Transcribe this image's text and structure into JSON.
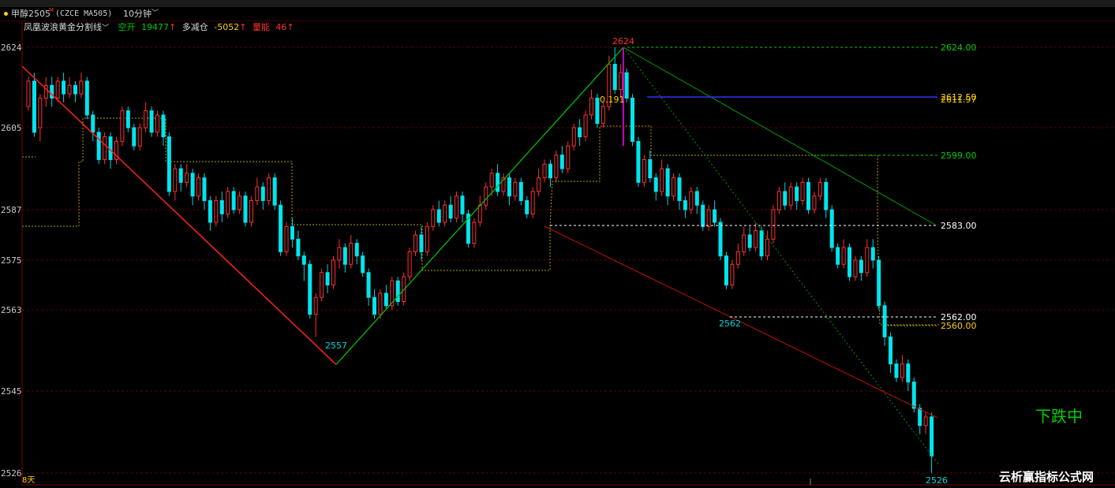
{
  "header": {
    "symbol": "甲醇2505",
    "symbol_mark": "M",
    "code": "(CZCE MA505)",
    "period": "10分钟",
    "period_icon": "chevron-down-icon"
  },
  "indicator": {
    "name": "凤凰波浪黄金分割线",
    "name_icon": "chevron-down-icon",
    "open_label": "空开",
    "open_value": "19477",
    "reduce_label": "多减仓",
    "reduce_value": "-5052",
    "volume_label": "量能",
    "volume_value": "46",
    "up_arrow": "↑"
  },
  "status_text": "下跌中",
  "watermark": "云析赢指标公式网",
  "days_label": "8天",
  "colors": {
    "up": "#ff3030",
    "down": "#00e5ee",
    "green": "#00c000",
    "yellow": "#ffd000",
    "blue": "#3030ff",
    "grid": "#5a0000"
  },
  "chart_data": {
    "type": "candlestick",
    "y_ticks": [
      "2624",
      "2605",
      "2587",
      "2575",
      "2563",
      "2545",
      "2526"
    ],
    "ylim": [
      2526,
      2624
    ],
    "pivot_labels": [
      "2624",
      "2557",
      "2562",
      "2526"
    ],
    "levels": [
      {
        "label": "2624.00",
        "value": 2624.0
      },
      {
        "label": "2612.50",
        "value": 2612.5
      },
      {
        "label": "2611.97",
        "value": 2611.97
      },
      {
        "label": "2599.00",
        "value": 2599.0
      },
      {
        "label": "2583.00",
        "value": 2583.0
      },
      {
        "label": "2562.00",
        "value": 2562.0
      },
      {
        "label": "2560.00",
        "value": 2560.0
      }
    ],
    "fib_label": "0.191",
    "zigzag": [
      {
        "bar": 0,
        "price": 2620
      },
      {
        "bar": 75,
        "price": 2557
      },
      {
        "bar": 143,
        "price": 2624
      },
      {
        "bar": 210,
        "price": 2562
      },
      {
        "bar": 210,
        "price": 2526
      }
    ],
    "candles": [
      [
        2610,
        2616,
        2609,
        2617
      ],
      [
        2616,
        2604,
        2603,
        2618
      ],
      [
        2605,
        2612,
        2602,
        2613
      ],
      [
        2612,
        2615,
        2610,
        2617
      ],
      [
        2615,
        2612,
        2610,
        2617
      ],
      [
        2612,
        2616,
        2611,
        2617
      ],
      [
        2616,
        2613,
        2611,
        2618
      ],
      [
        2613,
        2615,
        2612,
        2617
      ],
      [
        2615,
        2613,
        2611,
        2616
      ],
      [
        2613,
        2616,
        2612,
        2618
      ],
      [
        2616,
        2608,
        2607,
        2617
      ],
      [
        2608,
        2604,
        2602,
        2609
      ],
      [
        2604,
        2598,
        2597,
        2605
      ],
      [
        2598,
        2603,
        2597,
        2604
      ],
      [
        2603,
        2598,
        2596,
        2604
      ],
      [
        2598,
        2602,
        2597,
        2603
      ],
      [
        2602,
        2609,
        2601,
        2610
      ],
      [
        2609,
        2605,
        2604,
        2610
      ],
      [
        2605,
        2601,
        2600,
        2606
      ],
      [
        2601,
        2605,
        2600,
        2606
      ],
      [
        2605,
        2609,
        2604,
        2611
      ],
      [
        2609,
        2604,
        2603,
        2610
      ],
      [
        2604,
        2608,
        2603,
        2609
      ],
      [
        2608,
        2603,
        2601,
        2609
      ],
      [
        2603,
        2591,
        2590,
        2604
      ],
      [
        2591,
        2596,
        2589,
        2597
      ],
      [
        2596,
        2593,
        2591,
        2597
      ],
      [
        2593,
        2595,
        2592,
        2597
      ],
      [
        2595,
        2590,
        2588,
        2596
      ],
      [
        2590,
        2594,
        2589,
        2595
      ],
      [
        2594,
        2589,
        2587,
        2595
      ],
      [
        2589,
        2584,
        2582,
        2590
      ],
      [
        2584,
        2589,
        2583,
        2590
      ],
      [
        2589,
        2586,
        2584,
        2591
      ],
      [
        2586,
        2591,
        2585,
        2592
      ],
      [
        2591,
        2587,
        2586,
        2592
      ],
      [
        2587,
        2590,
        2586,
        2591
      ],
      [
        2590,
        2584,
        2583,
        2591
      ],
      [
        2584,
        2589,
        2583,
        2590
      ],
      [
        2589,
        2592,
        2588,
        2594
      ],
      [
        2592,
        2589,
        2587,
        2593
      ],
      [
        2589,
        2594,
        2588,
        2595
      ],
      [
        2594,
        2588,
        2587,
        2595
      ],
      [
        2588,
        2577,
        2576,
        2589
      ],
      [
        2577,
        2583,
        2576,
        2584
      ],
      [
        2583,
        2580,
        2578,
        2585
      ],
      [
        2580,
        2576,
        2575,
        2582
      ],
      [
        2576,
        2574,
        2570,
        2577
      ],
      [
        2574,
        2562,
        2561,
        2575
      ],
      [
        2562,
        2566,
        2557,
        2567
      ],
      [
        2566,
        2572,
        2565,
        2573
      ],
      [
        2572,
        2569,
        2567,
        2574
      ],
      [
        2569,
        2575,
        2568,
        2576
      ],
      [
        2575,
        2578,
        2573,
        2580
      ],
      [
        2578,
        2574,
        2572,
        2579
      ],
      [
        2574,
        2579,
        2573,
        2581
      ],
      [
        2579,
        2576,
        2574,
        2580
      ],
      [
        2576,
        2572,
        2571,
        2577
      ],
      [
        2572,
        2566,
        2564,
        2573
      ],
      [
        2566,
        2562,
        2561,
        2568
      ],
      [
        2562,
        2567,
        2561,
        2568
      ],
      [
        2567,
        2564,
        2563,
        2569
      ],
      [
        2564,
        2570,
        2563,
        2571
      ],
      [
        2570,
        2565,
        2564,
        2571
      ],
      [
        2565,
        2571,
        2564,
        2572
      ],
      [
        2571,
        2577,
        2570,
        2578
      ],
      [
        2577,
        2581,
        2576,
        2582
      ],
      [
        2581,
        2577,
        2575,
        2583
      ],
      [
        2577,
        2583,
        2576,
        2584
      ],
      [
        2583,
        2587,
        2582,
        2588
      ],
      [
        2587,
        2584,
        2583,
        2589
      ],
      [
        2584,
        2588,
        2583,
        2589
      ],
      [
        2588,
        2585,
        2584,
        2590
      ],
      [
        2585,
        2590,
        2584,
        2591
      ],
      [
        2590,
        2586,
        2584,
        2591
      ],
      [
        2586,
        2579,
        2578,
        2587
      ],
      [
        2579,
        2584,
        2578,
        2585
      ],
      [
        2584,
        2588,
        2583,
        2590
      ],
      [
        2588,
        2592,
        2587,
        2593
      ],
      [
        2592,
        2595,
        2590,
        2596
      ],
      [
        2595,
        2591,
        2590,
        2597
      ],
      [
        2591,
        2594,
        2590,
        2595
      ],
      [
        2594,
        2590,
        2588,
        2595
      ],
      [
        2590,
        2593,
        2589,
        2594
      ],
      [
        2593,
        2589,
        2588,
        2594
      ],
      [
        2589,
        2586,
        2585,
        2590
      ],
      [
        2586,
        2591,
        2585,
        2592
      ],
      [
        2591,
        2594,
        2590,
        2596
      ],
      [
        2594,
        2597,
        2593,
        2598
      ],
      [
        2597,
        2594,
        2592,
        2598
      ],
      [
        2594,
        2599,
        2593,
        2600
      ],
      [
        2599,
        2596,
        2595,
        2601
      ],
      [
        2596,
        2601,
        2595,
        2602
      ],
      [
        2601,
        2605,
        2600,
        2606
      ],
      [
        2605,
        2603,
        2601,
        2607
      ],
      [
        2603,
        2608,
        2602,
        2609
      ],
      [
        2608,
        2612,
        2607,
        2614
      ],
      [
        2612,
        2606,
        2605,
        2613
      ],
      [
        2606,
        2610,
        2605,
        2611
      ],
      [
        2610,
        2620,
        2609,
        2622
      ],
      [
        2620,
        2614,
        2613,
        2624
      ],
      [
        2614,
        2618,
        2612,
        2620
      ],
      [
        2618,
        2612,
        2611,
        2619
      ],
      [
        2612,
        2602,
        2601,
        2613
      ],
      [
        2602,
        2593,
        2592,
        2603
      ],
      [
        2593,
        2598,
        2592,
        2599
      ],
      [
        2598,
        2594,
        2593,
        2600
      ],
      [
        2594,
        2591,
        2589,
        2595
      ],
      [
        2591,
        2596,
        2590,
        2598
      ],
      [
        2596,
        2590,
        2588,
        2597
      ],
      [
        2590,
        2594,
        2589,
        2595
      ],
      [
        2594,
        2589,
        2587,
        2595
      ],
      [
        2589,
        2587,
        2585,
        2590
      ],
      [
        2587,
        2591,
        2586,
        2592
      ],
      [
        2591,
        2588,
        2586,
        2592
      ],
      [
        2588,
        2583,
        2582,
        2589
      ],
      [
        2583,
        2587,
        2582,
        2588
      ],
      [
        2587,
        2584,
        2583,
        2589
      ],
      [
        2584,
        2576,
        2575,
        2585
      ],
      [
        2576,
        2569,
        2568,
        2577
      ],
      [
        2569,
        2574,
        2568,
        2575
      ],
      [
        2574,
        2577,
        2573,
        2579
      ],
      [
        2577,
        2581,
        2576,
        2583
      ],
      [
        2581,
        2578,
        2577,
        2583
      ],
      [
        2578,
        2582,
        2577,
        2584
      ],
      [
        2582,
        2576,
        2575,
        2583
      ],
      [
        2576,
        2580,
        2575,
        2582
      ],
      [
        2580,
        2587,
        2579,
        2588
      ],
      [
        2587,
        2591,
        2586,
        2592
      ],
      [
        2591,
        2588,
        2587,
        2593
      ],
      [
        2588,
        2592,
        2587,
        2593
      ],
      [
        2592,
        2589,
        2587,
        2593
      ],
      [
        2589,
        2593,
        2588,
        2594
      ],
      [
        2593,
        2587,
        2586,
        2594
      ],
      [
        2587,
        2590,
        2586,
        2591
      ],
      [
        2590,
        2593,
        2589,
        2594
      ],
      [
        2593,
        2587,
        2585,
        2594
      ],
      [
        2587,
        2578,
        2577,
        2588
      ],
      [
        2578,
        2574,
        2573,
        2579
      ],
      [
        2574,
        2578,
        2573,
        2580
      ],
      [
        2578,
        2571,
        2570,
        2579
      ],
      [
        2571,
        2575,
        2570,
        2576
      ],
      [
        2575,
        2572,
        2570,
        2576
      ],
      [
        2572,
        2578,
        2571,
        2580
      ],
      [
        2578,
        2575,
        2573,
        2580
      ],
      [
        2575,
        2564,
        2563,
        2576
      ],
      [
        2564,
        2557,
        2555,
        2565
      ],
      [
        2557,
        2551,
        2549,
        2558
      ],
      [
        2551,
        2548,
        2547,
        2552
      ],
      [
        2548,
        2551,
        2547,
        2553
      ],
      [
        2551,
        2547,
        2545,
        2552
      ],
      [
        2547,
        2541,
        2540,
        2548
      ],
      [
        2541,
        2537,
        2535,
        2542
      ],
      [
        2537,
        2539,
        2535,
        2540
      ],
      [
        2539,
        2530,
        2526,
        2540
      ]
    ]
  }
}
